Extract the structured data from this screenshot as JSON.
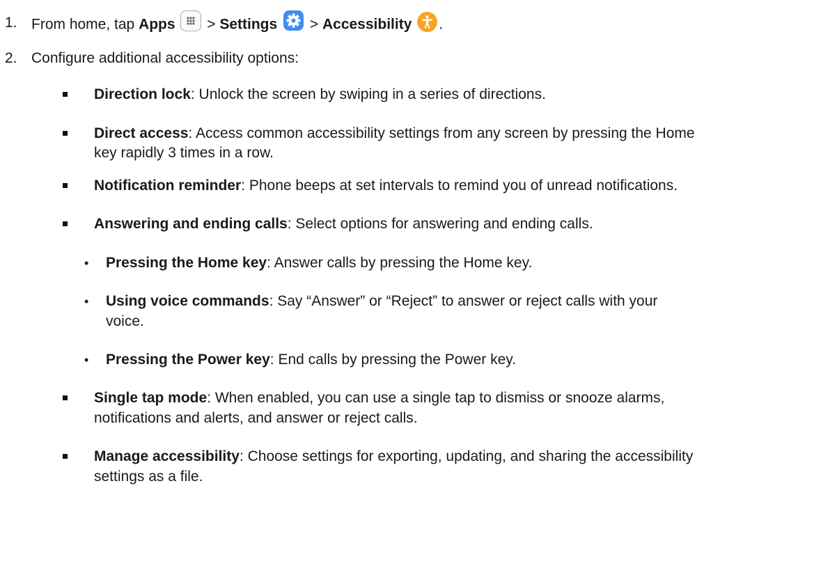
{
  "step1": {
    "number": "1.",
    "prefix": "From home, tap ",
    "apps": "Apps",
    "sep1": " > ",
    "settings": "Settings",
    "sep2": " > ",
    "accessibility": "Accessibility",
    "end": ".",
    "icons": [
      "apps-grid-icon",
      "settings-gear-icon",
      "accessibility-person-icon"
    ]
  },
  "step2": {
    "number": "2.",
    "text": "Configure additional accessibility options:"
  },
  "options": [
    {
      "term": "Direction lock",
      "line1": ": Unlock the screen by swiping in a series of directions."
    },
    {
      "term": "Direct access",
      "line1": ": Access common accessibility settings from any screen by pressing the Home",
      "line2": "key rapidly 3 times in a row."
    },
    {
      "term": "Notification reminder",
      "line1": ": Phone beeps at set intervals to remind you of unread notifications."
    },
    {
      "term": "Answering and ending calls",
      "line1": ": Select options for answering and ending calls."
    },
    {
      "term": "Single tap mode",
      "line1": ": When enabled, you can use a single tap to dismiss or snooze alarms,",
      "line2": "notifications and alerts, and answer or reject calls."
    },
    {
      "term": "Manage accessibility",
      "line1": ": Choose settings for exporting, updating, and sharing the accessibility",
      "line2": "settings as a file."
    }
  ],
  "suboptions": [
    {
      "term": "Pressing the Home key",
      "line1": ": Answer calls by pressing the Home key."
    },
    {
      "term": "Using voice commands",
      "line1": ": Say “Answer” or “Reject” to answer or reject calls with your",
      "line2": "voice."
    },
    {
      "term": "Pressing the Power key",
      "line1": ": End calls by pressing the Power key."
    }
  ]
}
